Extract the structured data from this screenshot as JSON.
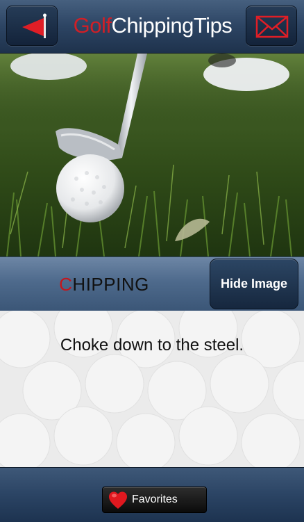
{
  "header": {
    "title_accent": "Golf",
    "title_rest": "ChippingTips",
    "back_icon": "back-flag-icon",
    "mail_icon": "mail-icon"
  },
  "category": {
    "label_first": "C",
    "label_rest": "HIPPING",
    "hide_button": "Hide Image"
  },
  "tip": {
    "text": "Choke down to the steel."
  },
  "footer": {
    "favorites_label": "Favorites",
    "favorites_icon": "heart-icon"
  },
  "colors": {
    "accent_red": "#d11f26",
    "navy": "#2d4564"
  }
}
